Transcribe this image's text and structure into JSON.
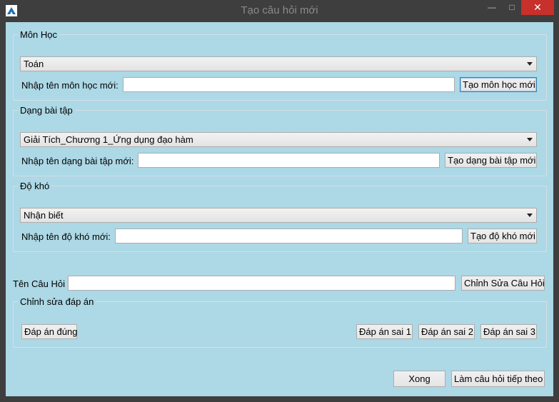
{
  "window": {
    "title": "Tạo câu hỏi mới",
    "minimize_glyph": "—",
    "maximize_glyph": "□",
    "close_glyph": "✕",
    "icon": "app-logo-icon"
  },
  "subject": {
    "legend": "Môn Học",
    "selected": "Toán",
    "new_label": "Nhập tên môn học mới:",
    "new_value": "",
    "create_button": "Tạo môn học mới"
  },
  "exercise_type": {
    "legend": "Dạng bài tập",
    "selected": "Giải Tích_Chương 1_Ứng dụng đạo hàm",
    "new_label": "Nhập tên dạng bài tập mới:",
    "new_value": "",
    "create_button": "Tạo dạng bài tập mới"
  },
  "difficulty": {
    "legend": "Độ khó",
    "selected": "Nhận biết",
    "new_label": "Nhập tên độ khó mới:",
    "new_value": "",
    "create_button": "Tạo độ khó mới"
  },
  "question": {
    "label": "Tên Câu Hỏi",
    "value": "",
    "edit_button": "Chỉnh Sửa Câu Hỏi"
  },
  "answers": {
    "legend": "Chỉnh sửa đáp án",
    "correct_button": "Đáp án đúng",
    "wrong1_button": "Đáp án sai 1",
    "wrong2_button": "Đáp án sai 2",
    "wrong3_button": "Đáp án sai 3"
  },
  "footer": {
    "done_button": "Xong",
    "next_button": "Làm câu hỏi tiếp theo"
  }
}
